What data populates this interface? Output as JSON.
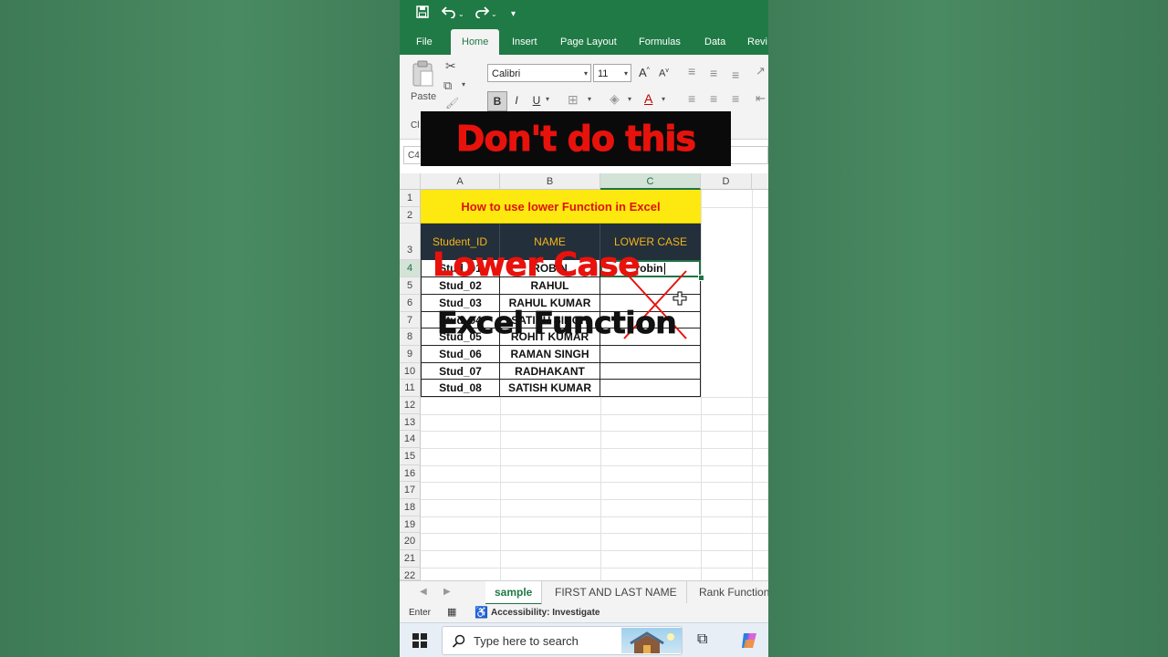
{
  "quick_access": {
    "save_icon": "save-icon",
    "undo_icon": "undo-icon",
    "redo_icon": "redo-icon"
  },
  "tabs": [
    {
      "label": "File"
    },
    {
      "label": "Home"
    },
    {
      "label": "Insert"
    },
    {
      "label": "Page Layout"
    },
    {
      "label": "Formulas"
    },
    {
      "label": "Data"
    },
    {
      "label": "Revi"
    }
  ],
  "ribbon": {
    "paste_label": "Paste",
    "clipboard_group_label": "Cl",
    "font_name": "Calibri",
    "font_size": "11",
    "grow_font": "A",
    "shrink_font": "A",
    "bold": "B",
    "italic": "I",
    "underline": "U",
    "font_color": "A"
  },
  "name_box": "C4",
  "banner_text": "Don't do this",
  "columns": [
    "A",
    "B",
    "C",
    "D"
  ],
  "rows": [
    "1",
    "2",
    "3",
    "4",
    "5",
    "6",
    "7",
    "8",
    "9",
    "10",
    "11",
    "12",
    "13",
    "14",
    "15",
    "16",
    "17",
    "18",
    "19",
    "20",
    "21",
    "22"
  ],
  "table": {
    "title": "How to use lower Function in Excel",
    "headers": [
      "Student_ID",
      "NAME",
      "LOWER CASE"
    ],
    "records": [
      {
        "id": "Stud_01",
        "name": "ROBIN",
        "lower": "robin"
      },
      {
        "id": "Stud_02",
        "name": "RAHUL",
        "lower": ""
      },
      {
        "id": "Stud_03",
        "name": "RAHUL KUMAR",
        "lower": ""
      },
      {
        "id": "Stud_04",
        "name": "SATISH SINGH",
        "lower": ""
      },
      {
        "id": "Stud_05",
        "name": "ROHIT KUMAR",
        "lower": ""
      },
      {
        "id": "Stud_06",
        "name": "RAMAN SINGH",
        "lower": ""
      },
      {
        "id": "Stud_07",
        "name": "RADHAKANT",
        "lower": ""
      },
      {
        "id": "Stud_08",
        "name": "SATISH KUMAR",
        "lower": ""
      }
    ]
  },
  "overlay": {
    "line1": "Lower Case",
    "line2": "Excel Function"
  },
  "sheet_tabs": [
    {
      "label": "sample"
    },
    {
      "label": "FIRST AND LAST NAME"
    },
    {
      "label": "Rank Function"
    }
  ],
  "status": {
    "mode": "Enter",
    "accessibility": "Accessibility: Investigate"
  },
  "taskbar": {
    "search_placeholder": "Type here to search"
  },
  "colors": {
    "excel_green": "#1f7a45",
    "title_yellow": "#fde910",
    "title_red": "#e0120b",
    "header_dark": "#232f3b",
    "header_text": "#f4b41a",
    "overlay_red": "#e8120c"
  }
}
